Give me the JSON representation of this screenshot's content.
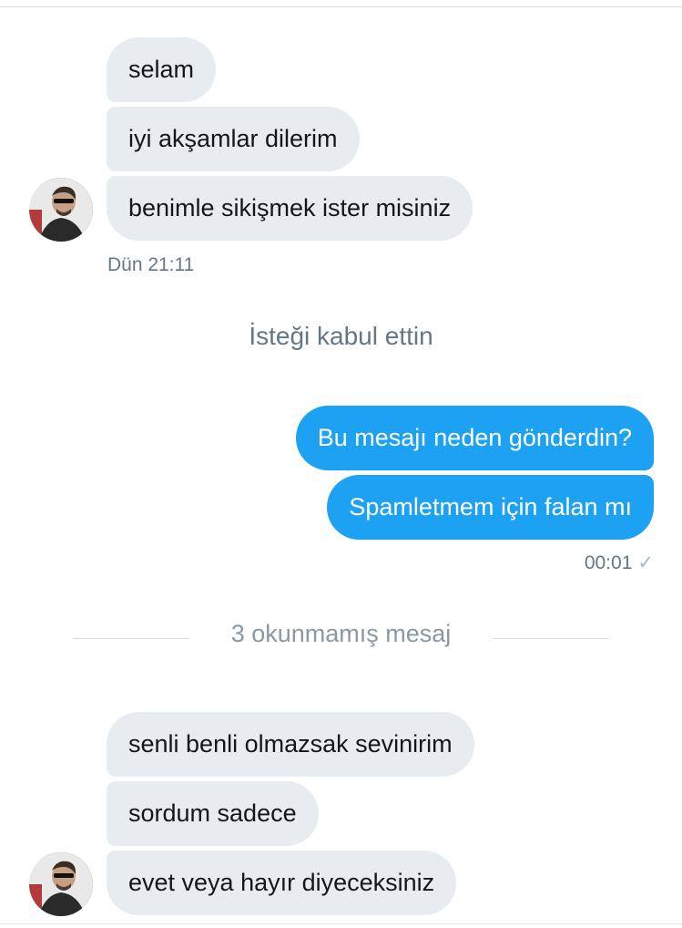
{
  "conversation": {
    "group1": {
      "messages": [
        "selam",
        "iyi akşamlar dilerim",
        "benimle sikişmek ister misiniz"
      ],
      "time": "Dün 21:11"
    },
    "system_notice": "İsteği kabul ettin",
    "group2": {
      "messages": [
        "Bu mesajı neden gönderdin?",
        "Spamletmem için falan mı"
      ],
      "time": "00:01",
      "status_icon": "✓"
    },
    "unread_divider": "3 okunmamış mesaj",
    "group3": {
      "messages": [
        "senli benli olmazsak sevinirim",
        "sordum sadece",
        "evet veya hayır diyeceksiniz"
      ]
    }
  },
  "colors": {
    "incoming_bubble": "#e6ecf0",
    "outgoing_bubble": "#1da1f2",
    "meta_text": "#657786"
  }
}
